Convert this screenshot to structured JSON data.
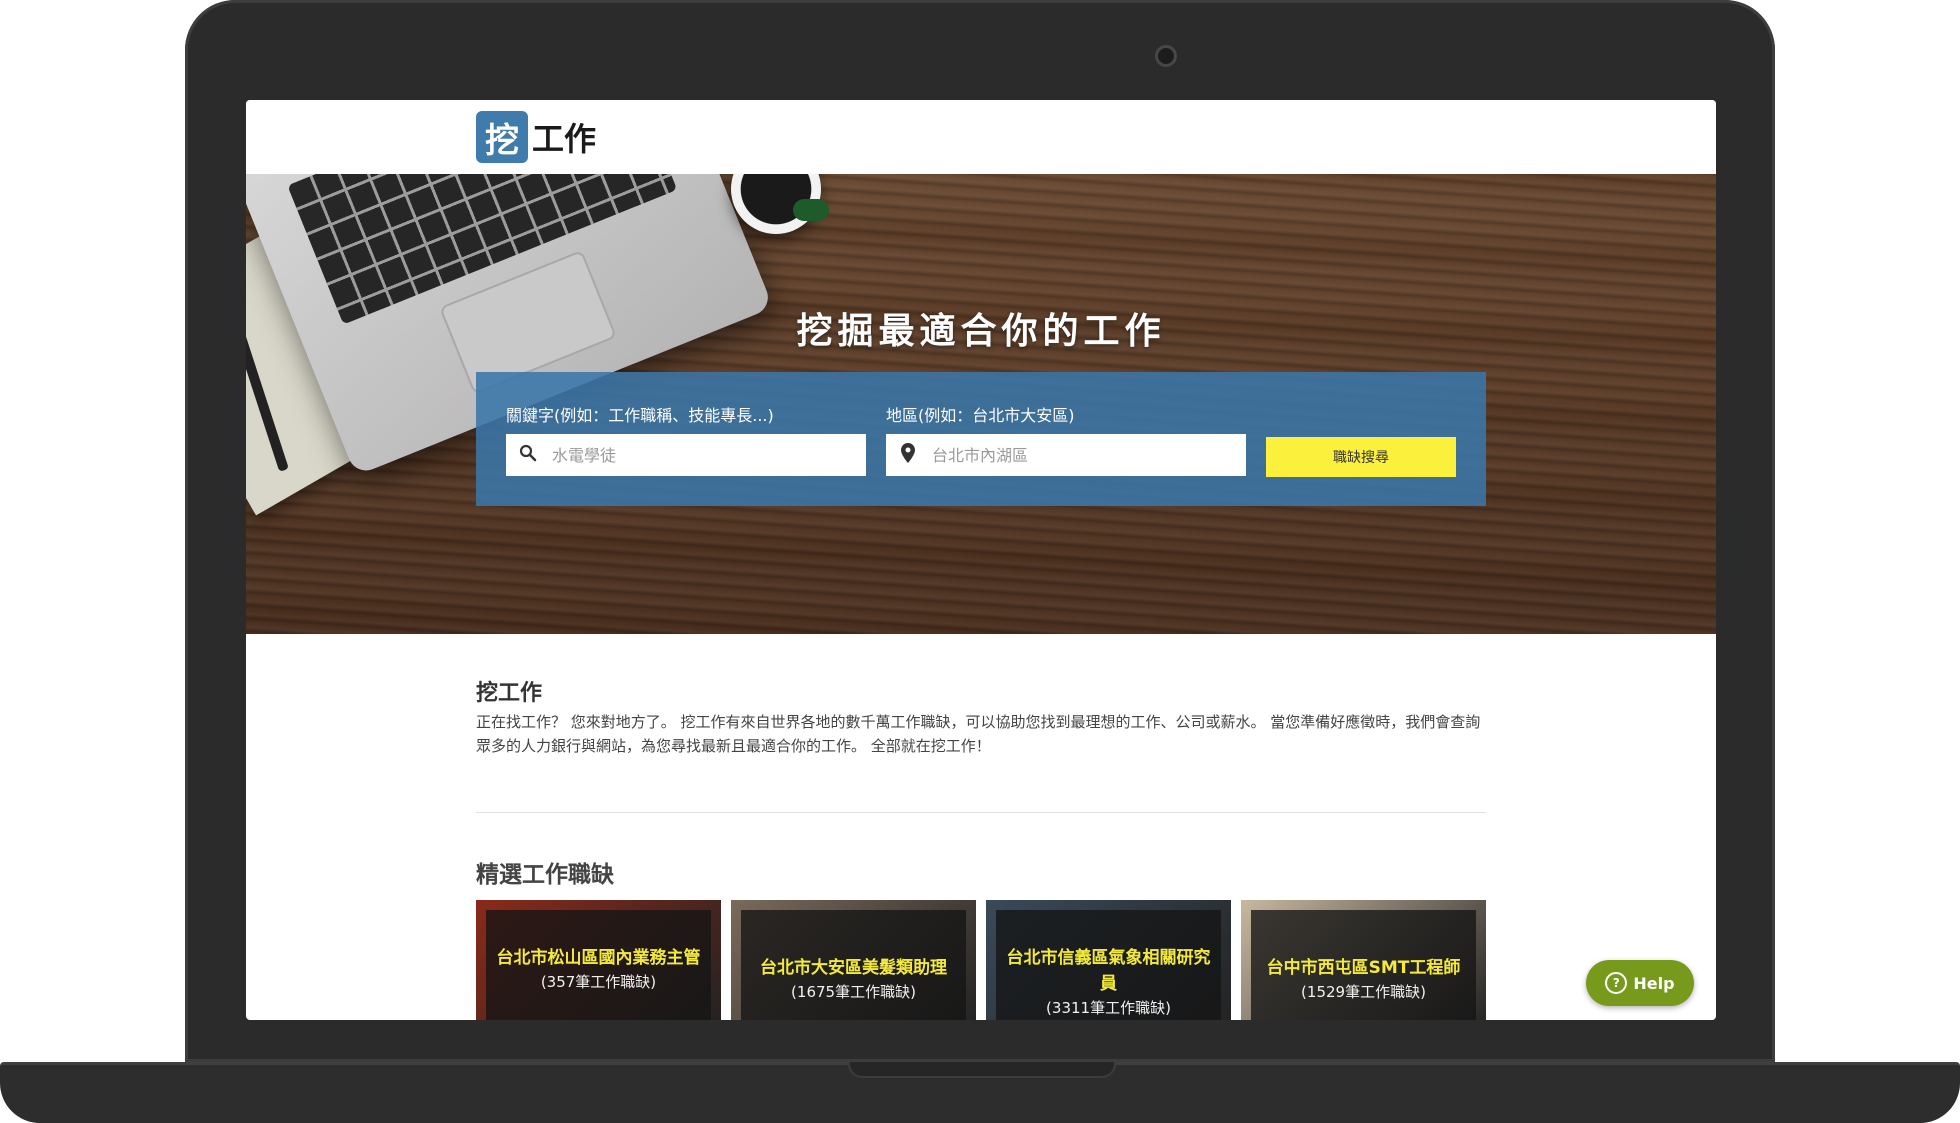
{
  "logo": {
    "mark": "挖",
    "text": "工作"
  },
  "hero": {
    "title": "挖掘最適合你的工作",
    "keyword_label": "關鍵字(例如：工作職稱、技能專長...)",
    "keyword_placeholder": "水電學徒",
    "location_label": "地區(例如：台北市大安區)",
    "location_placeholder": "台北市內湖區",
    "search_button": "職缺搜尋"
  },
  "intro": {
    "title": "挖工作",
    "text": "正在找工作？ 您來對地方了。 挖工作有來自世界各地的數千萬工作職缺，可以協助您找到最理想的工作、公司或薪水。 當您準備好應徵時，我們會查詢眾多的人力銀行與網站，為您尋找最新且最適合你的工作。 全部就在挖工作！"
  },
  "featured": {
    "title": "精選工作職缺",
    "cards": [
      {
        "title": "台北市松山區國內業務主管",
        "count": "(357筆工作職缺)",
        "bg": "#8a2a1a"
      },
      {
        "title": "台北市大安區美髮類助理",
        "count": "(1675筆工作職缺)",
        "bg": "#7a6a5a"
      },
      {
        "title": "台北市信義區氣象相關研究員",
        "count": "(3311筆工作職缺)",
        "bg": "#3a4a5a"
      },
      {
        "title": "台中市西屯區SMT工程師",
        "count": "(1529筆工作職缺)",
        "bg": "#c8b8a0"
      }
    ]
  },
  "help": {
    "label": "Help"
  },
  "colors": {
    "brand": "#3f7bab",
    "search_button": "#fbf03c",
    "help": "#779a1c",
    "card_title": "#f3ea3c"
  }
}
